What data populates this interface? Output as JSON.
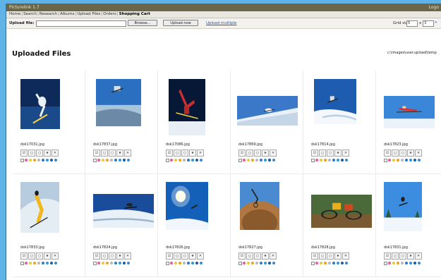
{
  "app": {
    "title": "Picturelink 1.7",
    "title_right": "Logo"
  },
  "nav": {
    "items": [
      {
        "label": "Home",
        "active": false
      },
      {
        "label": "Search",
        "active": false
      },
      {
        "label": "Research",
        "active": false
      },
      {
        "label": "Albums",
        "active": false
      },
      {
        "label": "Upload Files",
        "active": false
      },
      {
        "label": "Orders",
        "active": false
      },
      {
        "label": "Shopping Cart",
        "active": true
      }
    ]
  },
  "upload": {
    "label": "Upload file:",
    "file_value": "",
    "browse_label": "Browse...",
    "upload_label": "Upload now",
    "link_label": "Upload multiple",
    "grid_label": "Grid size",
    "grid_w": "5",
    "grid_h": "3",
    "go_label": "»"
  },
  "page": {
    "title": "Uploaded Files",
    "path": "c:\\images\\user.upload\\temp"
  },
  "toolbar_icons": [
    "edit-icon",
    "crop-icon",
    "rotate-icon",
    "star-icon",
    "delete-icon"
  ],
  "toolbar_glyphs": [
    "☑",
    "◻",
    "○",
    "★",
    "✕"
  ],
  "label_colors": [
    "#ffffff",
    "#e85a9a",
    "#e8c83c",
    "#f0a020",
    "#b8b8b8",
    "#2a7ac8",
    "#2a9ad8",
    "#1a5aa8",
    "#3a8ad0"
  ],
  "files": [
    {
      "name": "dsk17031.jpg",
      "scene": "skier-jump-dark"
    },
    {
      "name": "dsk17837.jpg",
      "scene": "skier-sky-aerial"
    },
    {
      "name": "dsk17086.jpg",
      "scene": "skier-upside-dark"
    },
    {
      "name": "dsk17869.jpg",
      "scene": "skier-slope-wide"
    },
    {
      "name": "dsk17814.jpg",
      "scene": "skier-air-snow"
    },
    {
      "name": "dsk17823.jpg",
      "scene": "skier-red-sky"
    },
    {
      "name": "dsk17833.jpg",
      "scene": "skier-yellow-snow"
    },
    {
      "name": "dsk17824.jpg",
      "scene": "snowboard-sky-wide"
    },
    {
      "name": "dsk17826.jpg",
      "scene": "sun-snow-jump"
    },
    {
      "name": "dsk17827.jpg",
      "scene": "mtb-rock-desert"
    },
    {
      "name": "dsk17828.jpg",
      "scene": "mtb-riders-green"
    },
    {
      "name": "dsk17831.jpg",
      "scene": "skier-sky-trees"
    }
  ]
}
